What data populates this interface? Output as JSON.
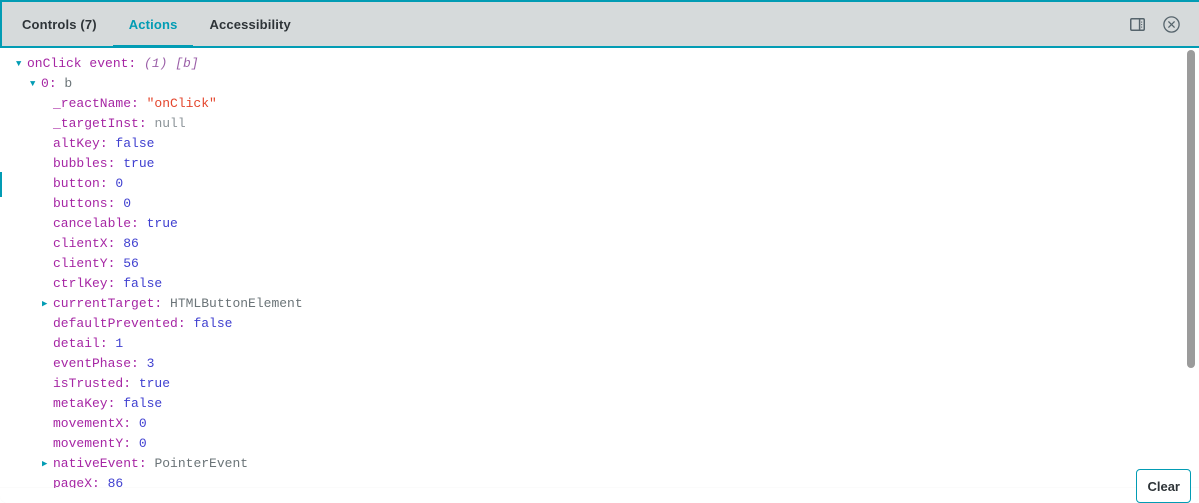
{
  "colors": {
    "accent": "#029cb4",
    "header_bg": "#d6dadb",
    "key": "#a626a4",
    "value_bool": "#4040d0",
    "value_string": "#e4452c",
    "value_null": "#8b9398",
    "value_object": "#6b7478",
    "text_dark": "#2e3438",
    "scrollbar": "#9b9b9b"
  },
  "header": {
    "tabs": [
      {
        "label": "Controls (7)",
        "active": false,
        "name": "tab-controls"
      },
      {
        "label": "Actions",
        "active": true,
        "name": "tab-actions"
      },
      {
        "label": "Accessibility",
        "active": false,
        "name": "tab-accessibility"
      }
    ],
    "icons": [
      {
        "name": "layout-panel-icon",
        "title": "Change addon orientation"
      },
      {
        "name": "close-circle-icon",
        "title": "Hide addons"
      }
    ]
  },
  "footer": {
    "clear_label": "Clear"
  },
  "log": {
    "rows": [
      {
        "arrow": "expanded",
        "indent": 0,
        "key": "onClick event",
        "key_style": "key",
        "value": "(1) [b]",
        "value_style": "meta"
      },
      {
        "arrow": "expanded",
        "indent": 1,
        "key": "0",
        "key_style": "key",
        "value": "b",
        "value_style": "object"
      },
      {
        "arrow": "none",
        "indent": 2,
        "key": "_reactName",
        "key_style": "key",
        "value": "\"onClick\"",
        "value_style": "string"
      },
      {
        "arrow": "none",
        "indent": 2,
        "key": "_targetInst",
        "key_style": "key",
        "value": "null",
        "value_style": "null"
      },
      {
        "arrow": "none",
        "indent": 2,
        "key": "altKey",
        "key_style": "key",
        "value": "false",
        "value_style": "bool"
      },
      {
        "arrow": "none",
        "indent": 2,
        "key": "bubbles",
        "key_style": "key",
        "value": "true",
        "value_style": "bool"
      },
      {
        "arrow": "none",
        "indent": 2,
        "key": "button",
        "key_style": "key",
        "value": "0",
        "value_style": "num"
      },
      {
        "arrow": "none",
        "indent": 2,
        "key": "buttons",
        "key_style": "key",
        "value": "0",
        "value_style": "num"
      },
      {
        "arrow": "none",
        "indent": 2,
        "key": "cancelable",
        "key_style": "key",
        "value": "true",
        "value_style": "bool"
      },
      {
        "arrow": "none",
        "indent": 2,
        "key": "clientX",
        "key_style": "key",
        "value": "86",
        "value_style": "num"
      },
      {
        "arrow": "none",
        "indent": 2,
        "key": "clientY",
        "key_style": "key",
        "value": "56",
        "value_style": "num"
      },
      {
        "arrow": "none",
        "indent": 2,
        "key": "ctrlKey",
        "key_style": "key",
        "value": "false",
        "value_style": "bool"
      },
      {
        "arrow": "collapsed",
        "indent": 2,
        "key": "currentTarget",
        "key_style": "key",
        "value": "HTMLButtonElement",
        "value_style": "object"
      },
      {
        "arrow": "none",
        "indent": 2,
        "key": "defaultPrevented",
        "key_style": "key",
        "value": "false",
        "value_style": "bool"
      },
      {
        "arrow": "none",
        "indent": 2,
        "key": "detail",
        "key_style": "key",
        "value": "1",
        "value_style": "num"
      },
      {
        "arrow": "none",
        "indent": 2,
        "key": "eventPhase",
        "key_style": "key",
        "value": "3",
        "value_style": "num"
      },
      {
        "arrow": "none",
        "indent": 2,
        "key": "isTrusted",
        "key_style": "key",
        "value": "true",
        "value_style": "bool"
      },
      {
        "arrow": "none",
        "indent": 2,
        "key": "metaKey",
        "key_style": "key",
        "value": "false",
        "value_style": "bool"
      },
      {
        "arrow": "none",
        "indent": 2,
        "key": "movementX",
        "key_style": "key",
        "value": "0",
        "value_style": "num"
      },
      {
        "arrow": "none",
        "indent": 2,
        "key": "movementY",
        "key_style": "key",
        "value": "0",
        "value_style": "num"
      },
      {
        "arrow": "collapsed",
        "indent": 2,
        "key": "nativeEvent",
        "key_style": "key",
        "value": "PointerEvent",
        "value_style": "object"
      },
      {
        "arrow": "none",
        "indent": 2,
        "key": "pageX",
        "key_style": "key",
        "value": "86",
        "value_style": "num"
      }
    ]
  }
}
